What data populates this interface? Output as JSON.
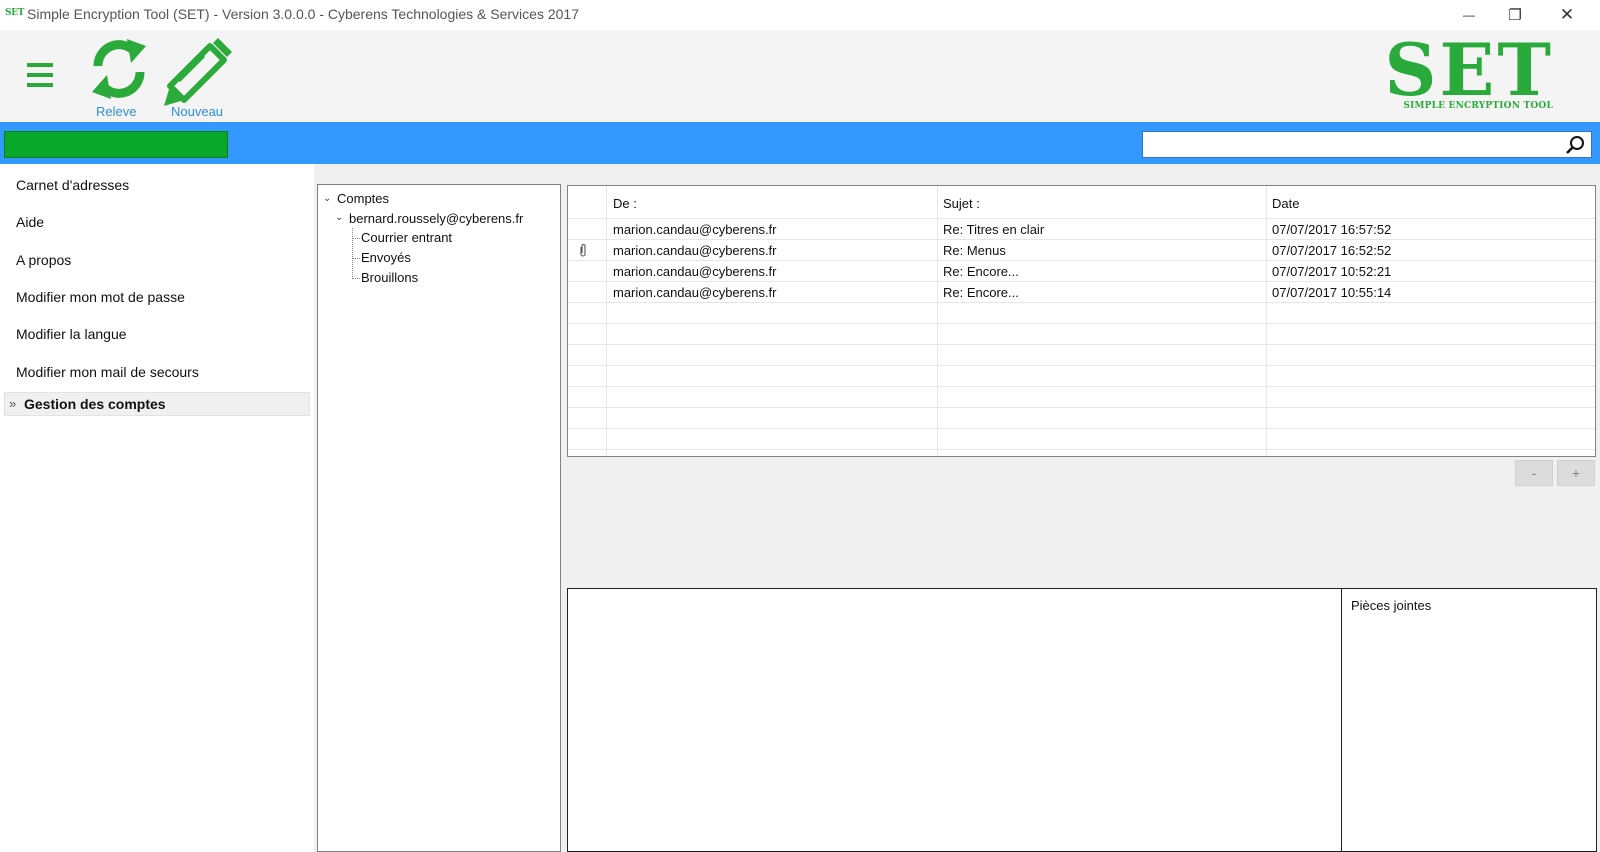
{
  "window": {
    "logo_text": "SET",
    "title": "Simple Encryption Tool (SET) - Version 3.0.0.0 - Cyberens Technologies & Services 2017",
    "minimize_glyph": "—",
    "maximize_glyph": "❐",
    "close_glyph": "✕"
  },
  "toolbar": {
    "menu_icon": "hamburger-icon",
    "refresh": {
      "label": "Releve",
      "icon": "refresh-icon"
    },
    "new": {
      "label": "Nouveau",
      "icon": "pencil-icon"
    },
    "logo_big": "SET",
    "logo_small": "SIMPLE ENCRYPTION TOOL"
  },
  "search": {
    "value": "",
    "placeholder": "",
    "icon": "search-icon"
  },
  "progress": {
    "value": 1.0,
    "color": "#08a82a"
  },
  "nav": {
    "items": [
      {
        "label": "Carnet d'adresses"
      },
      {
        "label": "Aide"
      },
      {
        "label": "A propos"
      },
      {
        "label": "Modifier mon mot de passe"
      },
      {
        "label": "Modifier la langue"
      },
      {
        "label": "Modifier mon mail de secours"
      }
    ],
    "active": {
      "arrow": "»",
      "label": "Gestion des comptes"
    }
  },
  "tree": {
    "root": "Comptes",
    "account": "bernard.roussely@cyberens.fr",
    "folders": [
      "Courrier entrant",
      "Envoyés",
      "Brouillons"
    ],
    "caret": "⌄"
  },
  "mail_list": {
    "headers": {
      "from": "De :",
      "subject": "Sujet :",
      "date": "Date"
    },
    "rows": [
      {
        "attachment": false,
        "from": "marion.candau@cyberens.fr",
        "subject": "Re: Titres en clair",
        "date": "07/07/2017 16:57:52"
      },
      {
        "attachment": true,
        "from": "marion.candau@cyberens.fr",
        "subject": "Re: Menus",
        "date": "07/07/2017 16:52:52"
      },
      {
        "attachment": false,
        "from": "marion.candau@cyberens.fr",
        "subject": "Re: Encore...",
        "date": "07/07/2017 10:52:21"
      },
      {
        "attachment": false,
        "from": "marion.candau@cyberens.fr",
        "subject": "Re: Encore...",
        "date": "07/07/2017 10:55:14"
      }
    ]
  },
  "pager": {
    "minus": "-",
    "plus": "+"
  },
  "attachments": {
    "label": "Pièces jointes"
  },
  "colors": {
    "brand_green": "#2aaa3a",
    "bar_blue": "#3399ff",
    "label_blue": "#2f8fd8"
  }
}
